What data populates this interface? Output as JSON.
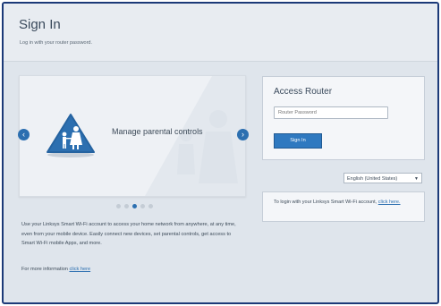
{
  "header": {
    "title": "Sign In",
    "subtitle": "Log in with your router password."
  },
  "carousel": {
    "slide_text": "Manage parental controls",
    "prev_icon": "chevron-left-icon",
    "next_icon": "chevron-right-icon",
    "slide_icon": "parental-controls-icon",
    "dot_count": 5,
    "active_dot": 3
  },
  "description": {
    "text": "Use your Linksys Smart Wi-Fi account to access your home network from anywhere, at any time, even from your mobile device. Easily connect new devices, set parental controls, get access to Smart Wi-Fi mobile Apps, and more.",
    "more_prefix": "For more information ",
    "more_link": "click here"
  },
  "access_router": {
    "title": "Access Router",
    "password_placeholder": "Router Password",
    "signin_label": "Sign In"
  },
  "language": {
    "selected": "English (United States)"
  },
  "info": {
    "text": "To login with your Linksys Smart Wi-Fi account, ",
    "link": "click here."
  },
  "colors": {
    "accent": "#2f79c0",
    "frame_border": "#1c3a78",
    "background": "#dfe5ec"
  }
}
